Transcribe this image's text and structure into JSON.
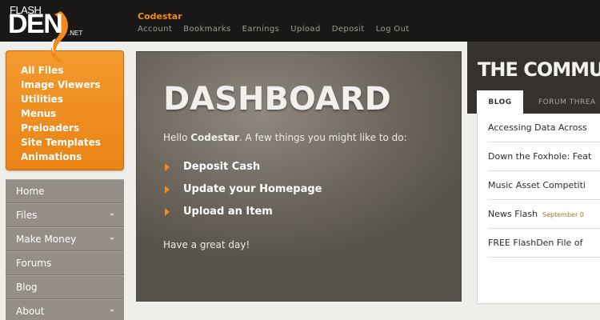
{
  "header": {
    "logo": {
      "flash": "FLASH",
      "den": "DEN",
      "net": ".NET"
    },
    "username": "Codestar",
    "nav": [
      "Account",
      "Bookmarks",
      "Earnings",
      "Upload",
      "Deposit",
      "Log Out"
    ]
  },
  "sidebar": {
    "file_links": [
      "All Files",
      "Image Viewers",
      "Utilities",
      "Menus",
      "Preloaders",
      "Site Templates",
      "Animations"
    ],
    "nav_items": [
      {
        "label": "Home",
        "has_arrow": false
      },
      {
        "label": "Files",
        "has_arrow": true
      },
      {
        "label": "Make Money",
        "has_arrow": true
      },
      {
        "label": "Forums",
        "has_arrow": false
      },
      {
        "label": "Blog",
        "has_arrow": false
      },
      {
        "label": "About",
        "has_arrow": true
      }
    ]
  },
  "dashboard": {
    "title": "DASHBOARD",
    "hello_prefix": "Hello ",
    "hello_name": "Codestar",
    "hello_suffix": ". A few things you might like to do:",
    "actions": [
      "Deposit Cash",
      "Update your Homepage",
      "Upload an Item"
    ],
    "closing": "Have a great day!"
  },
  "community": {
    "title": "THE COMMU",
    "tabs": {
      "blog": "BLOG",
      "forum": "FORUM THREA"
    },
    "items": [
      {
        "title": "Accessing Data Across",
        "date": ""
      },
      {
        "title": "Down the Foxhole: Feat",
        "date": ""
      },
      {
        "title": "Music Asset Competiti",
        "date": ""
      },
      {
        "title": "News Flash",
        "date": "September 0"
      },
      {
        "title": "FREE FlashDen File of",
        "date": ""
      }
    ]
  },
  "colors": {
    "accent_orange": "#f08a1c",
    "topbar": "#1a1816",
    "sidebar_nav": "#948e86",
    "dashboard_bg": "#6e685f"
  },
  "icons": {
    "logo_mark": "fox-flame-icon",
    "action_bullet": "orange-triangle-bullet-icon",
    "nav_dropdown": "chevron-down-icon"
  }
}
